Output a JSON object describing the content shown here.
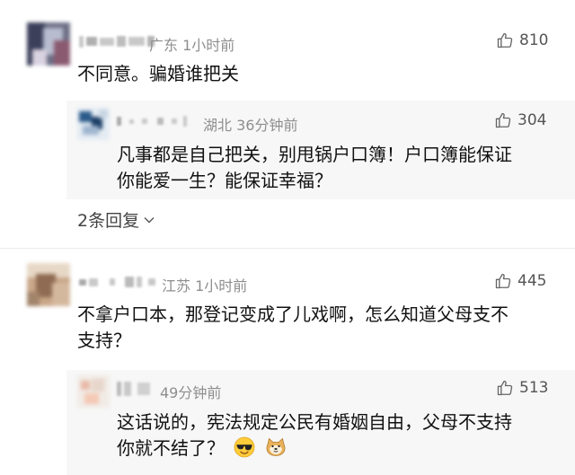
{
  "comments": [
    {
      "location_time": "广东 1小时前",
      "likes": "810",
      "text": "不同意。骗婚谁把关",
      "reply": {
        "location_time": "湖北 36分钟前",
        "likes": "304",
        "text_line1": "凡事都是自己把关，别甩锅户口簿！户口簿能保证",
        "text_line2": "你能爱一生？能保证幸福？"
      },
      "more_replies": "2条回复"
    },
    {
      "location_time": "江苏 1小时前",
      "likes": "445",
      "text_line1": "不拿户口本，那登记变成了儿戏啊，怎么知道父母支不",
      "text_line2": "支持？",
      "reply": {
        "location_time": "49分钟前",
        "likes": "513",
        "text_line1": "这话说的，宪法规定公民有婚姻自由，父母不支持",
        "text_line2": "你就不结了？",
        "emojis": [
          "cool-sunglasses-emoji",
          "doge-dog-emoji"
        ]
      }
    }
  ],
  "icons": {
    "like": "thumbs-up-icon",
    "expand": "chevron-down-icon"
  },
  "colors": {
    "meta_text": "#8e8e8e",
    "reply_background": "#f7f7f7"
  }
}
